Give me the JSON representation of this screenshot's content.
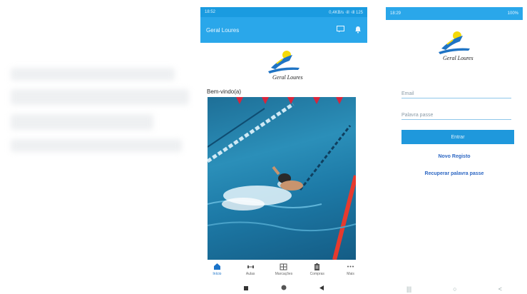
{
  "left_phone": {
    "status_time": "18:52",
    "status_right": "0,4KB/s ⋅ill ⋅ill 125",
    "app_title": "Geral Loures",
    "logo_text": "Geral Loures",
    "welcome": "Bem-vindo(a)",
    "nav": [
      {
        "label": "Início",
        "icon": "home-icon"
      },
      {
        "label": "Aulas",
        "icon": "dumbbell-icon"
      },
      {
        "label": "Marcações",
        "icon": "calendar-grid-icon"
      },
      {
        "label": "Compras",
        "icon": "clipboard-icon"
      },
      {
        "label": "Mais",
        "icon": "more-dots-icon"
      }
    ]
  },
  "right_phone": {
    "status_time": "18:29",
    "status_right": "100%",
    "logo_text": "Geral Loures",
    "email_placeholder": "Email",
    "password_placeholder": "Palavra passe",
    "enter_label": "Entrar",
    "register_label": "Novo Registo",
    "recover_label": "Recuperar palavra passe",
    "android_nav": [
      "|||",
      "○",
      "<"
    ]
  },
  "colors": {
    "primary": "#2aa7ea",
    "link": "#2d67c3",
    "pool": "#1d7aa7"
  }
}
